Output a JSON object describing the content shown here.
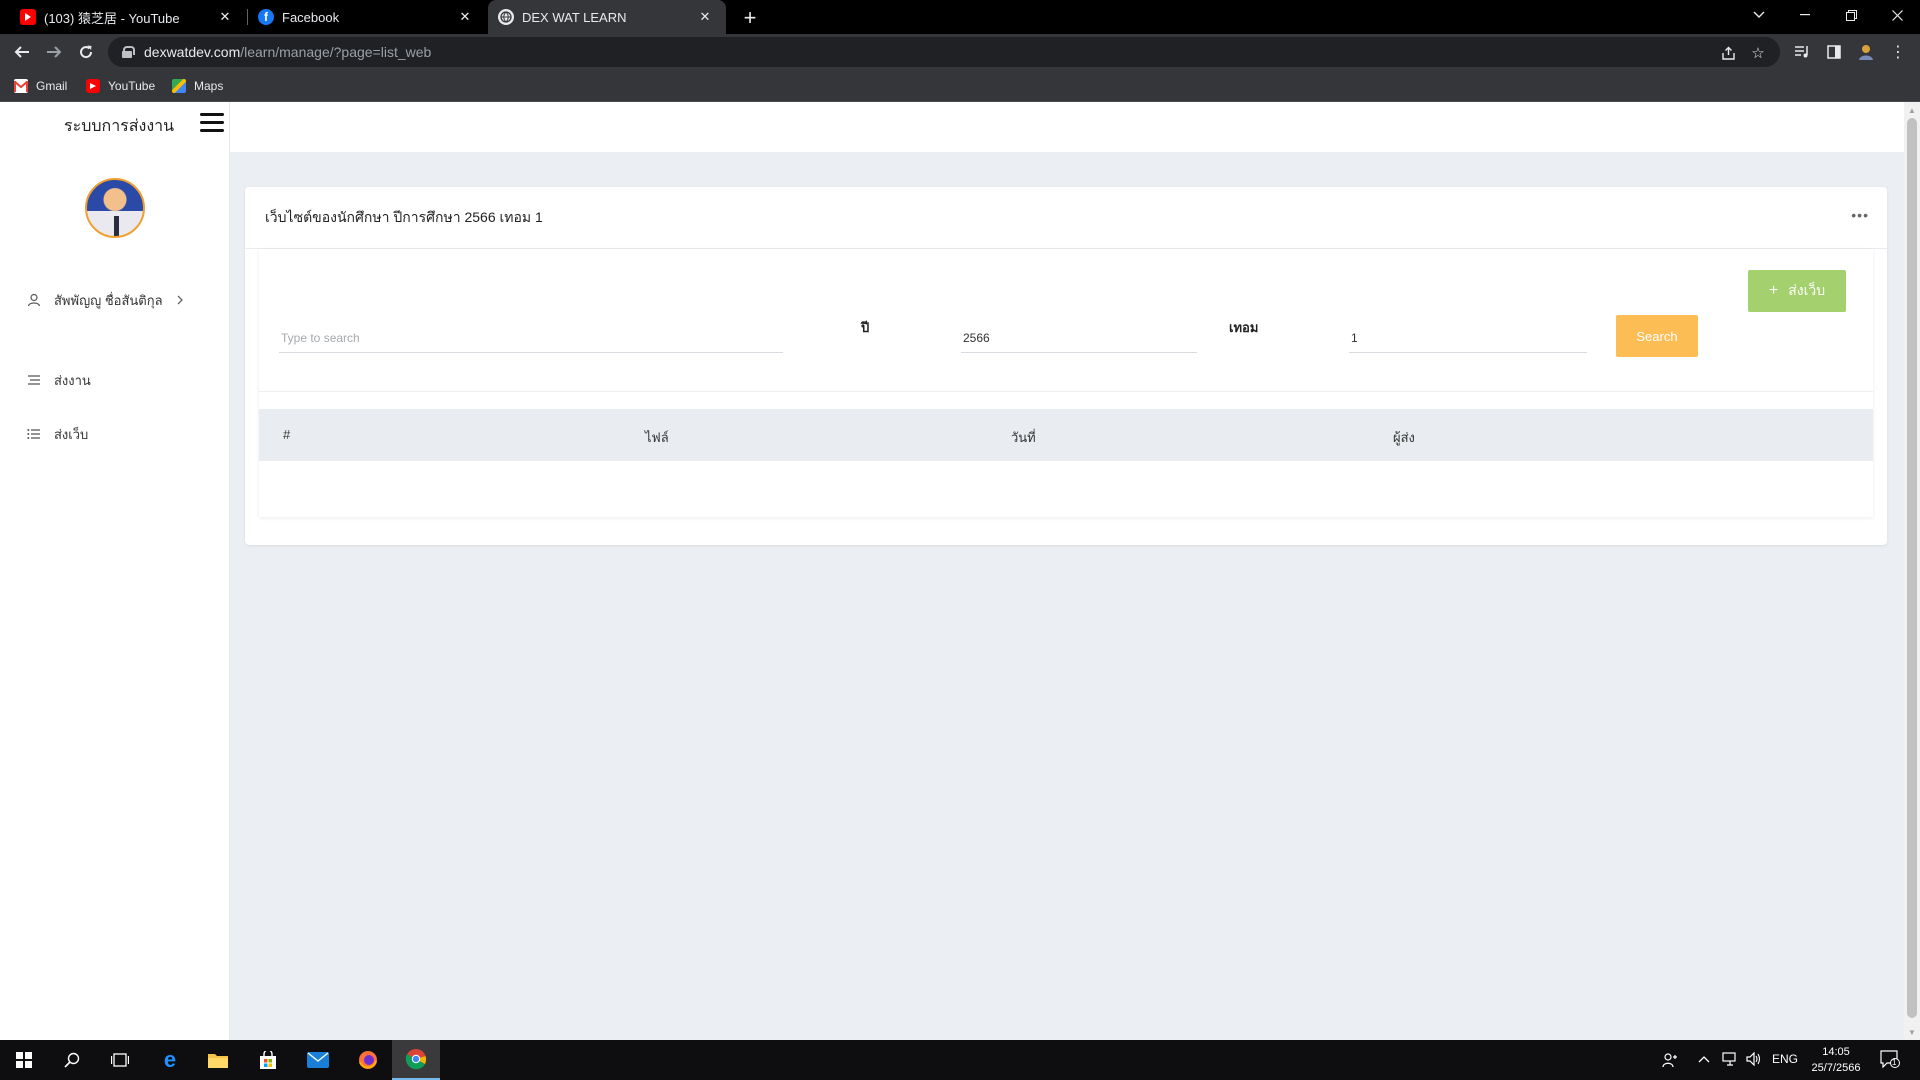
{
  "browser": {
    "tabs": [
      {
        "title": "(103) 猿芝居 - YouTube",
        "favicon": "youtube-icon",
        "active": false
      },
      {
        "title": "Facebook",
        "favicon": "facebook-icon",
        "active": false
      },
      {
        "title": "DEX WAT LEARN",
        "favicon": "globe-icon",
        "active": true
      }
    ],
    "url_domain": "dexwatdev.com",
    "url_path": "/learn/manage/?page=list_web",
    "bookmarks": [
      {
        "label": "Gmail",
        "icon": "gmail-icon"
      },
      {
        "label": "YouTube",
        "icon": "youtube-icon"
      },
      {
        "label": "Maps",
        "icon": "maps-icon"
      }
    ]
  },
  "app": {
    "brand": "ระบบการส่งงาน",
    "user_name": "สัพพัญญู ชื่อสันติกุล",
    "nav": [
      {
        "label": "ส่งงาน",
        "icon": "tasks-icon"
      },
      {
        "label": "ส่งเว็บ",
        "icon": "list-icon"
      }
    ]
  },
  "card": {
    "title": "เว็บไซต์ของนักศึกษา ปีการศึกษา 2566 เทอม 1",
    "send_button": "ส่งเว็บ",
    "search_placeholder": "Type to search",
    "year_label": "ปี",
    "year_value": "2566",
    "term_label": "เทอม",
    "term_value": "1",
    "search_button": "Search",
    "columns": [
      "#",
      "ไฟล์",
      "วันที่",
      "ผู้ส่ง"
    ]
  },
  "taskbar": {
    "language": "ENG",
    "time": "14:05",
    "date": "25/7/2566",
    "notification_count": "1"
  },
  "colors": {
    "send_button": "#a4d06e",
    "search_button": "#fbbd54",
    "page_background": "#ebeef2"
  }
}
